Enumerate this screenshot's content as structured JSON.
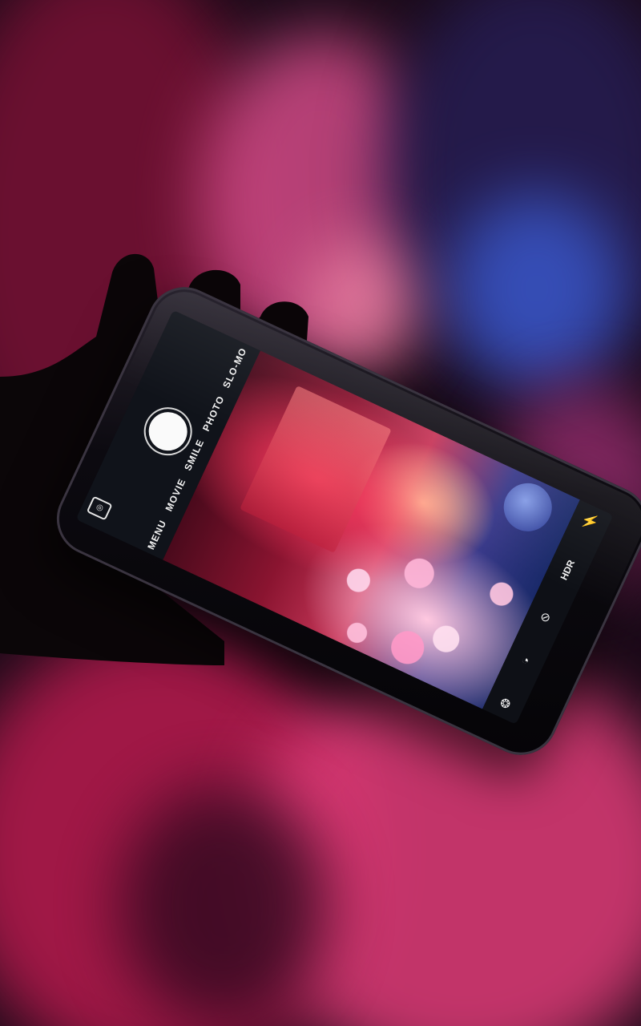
{
  "camera_app": {
    "modes": [
      "SLO-MO",
      "PHOTO",
      "SMILE",
      "MOVIE",
      "MENU"
    ],
    "hdr_label": "HDR",
    "icons": {
      "camera_switch": "camera-switch-icon",
      "shutter": "shutter-button",
      "flash": "flash-icon",
      "filter": "filter-icon",
      "timer": "timer-icon",
      "effects": "effects-icon"
    },
    "colors": {
      "flash_accent": "#ff7a1a",
      "panel": "#10131a",
      "text": "#f2f2f2"
    }
  }
}
